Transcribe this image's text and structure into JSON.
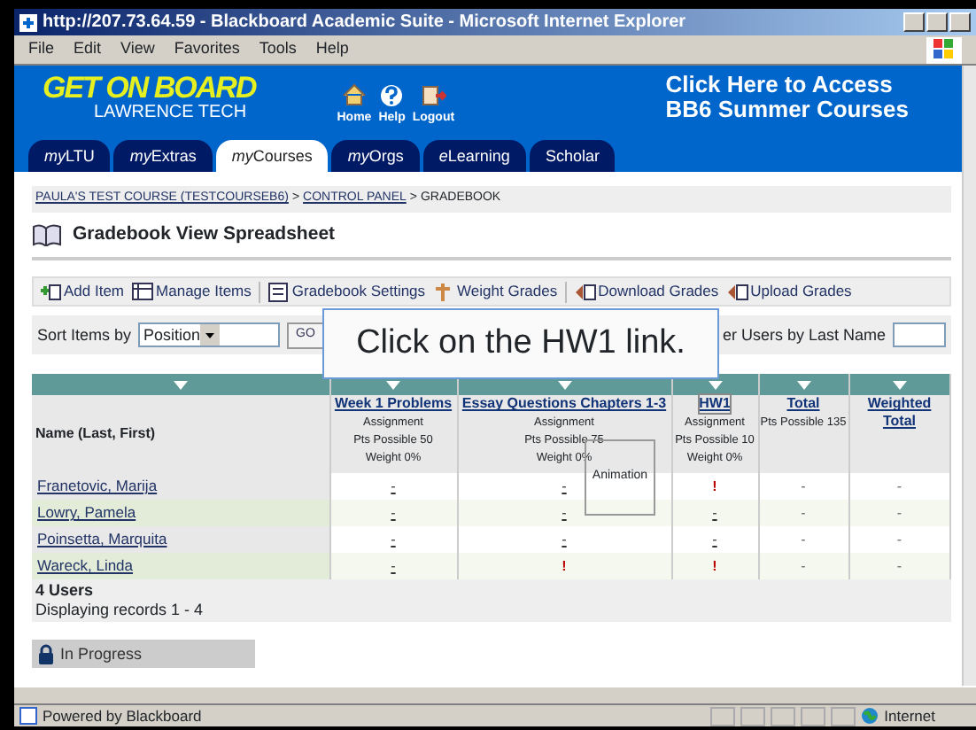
{
  "window": {
    "title": "http://207.73.64.59 - Blackboard Academic Suite - Microsoft Internet Explorer"
  },
  "menu": [
    "File",
    "Edit",
    "View",
    "Favorites",
    "Tools",
    "Help"
  ],
  "header": {
    "logo_top": "GET ON BOARD",
    "logo_bottom": "LAWRENCE TECH",
    "nav_links": [
      "Home",
      "Help",
      "Logout"
    ],
    "promo_lines": [
      "Click Here to Access",
      "BB6 Summer Courses"
    ]
  },
  "tabs": [
    {
      "prefix": "my",
      "label": "LTU",
      "selected": false
    },
    {
      "prefix": "my",
      "label": "Extras",
      "selected": false
    },
    {
      "prefix": "my",
      "label": "Courses",
      "selected": true
    },
    {
      "prefix": "my",
      "label": "Orgs",
      "selected": false
    },
    {
      "prefix": "e",
      "label": "Learning",
      "selected": false
    },
    {
      "label": "Scholar",
      "selected": false
    }
  ],
  "breadcrumb": [
    {
      "text": "PAULA'S TEST COURSE (TESTCOURSEB6)",
      "link": true,
      "separator": ">"
    },
    {
      "text": "CONTROL PANEL",
      "link": true,
      "separator": ">"
    },
    {
      "text": "GRADEBOOK",
      "link": false
    }
  ],
  "page_title": "Gradebook View Spreadsheet",
  "toolbar": [
    "Add Item",
    "Manage Items",
    "Gradebook Settings",
    "Weight Grades",
    "Download Grades",
    "Upload Grades"
  ],
  "sort": {
    "label": "Sort Items by",
    "value": "Position",
    "button": "GO"
  },
  "filter_label": "er Users by Last Name",
  "callout": "Click on the HW1 link.",
  "table": {
    "name_header": "Name (Last, First)",
    "columns": [
      {
        "title": "Week 1 Problems",
        "type": "Assignment",
        "points": "Pts Possible 50",
        "weight": "Weight 0%",
        "focused": false
      },
      {
        "title": "Essay Questions Chapters 1-3",
        "type": "Assignment",
        "points": "Pts Possible 75",
        "weight": "Weight 0%",
        "focused": false
      },
      {
        "title": "HW1",
        "type": "Assignment",
        "points": "Pts Possible 10",
        "weight": "Weight 0%",
        "focused": true
      },
      {
        "title": "Total",
        "points": "Pts Possible 135",
        "focused": false
      },
      {
        "title": "Weighted Total",
        "focused": false
      }
    ],
    "rows": [
      {
        "name": "Franetovic, Marija",
        "cells": [
          {
            "text": "-",
            "kind": "link"
          },
          {
            "text": "-",
            "kind": "link"
          },
          {
            "text": "!",
            "kind": "alert"
          },
          {
            "text": "-",
            "kind": "plain"
          },
          {
            "text": "-",
            "kind": "plain"
          }
        ]
      },
      {
        "name": "Lowry, Pamela",
        "cells": [
          {
            "text": "-",
            "kind": "link"
          },
          {
            "text": "-",
            "kind": "link"
          },
          {
            "text": "-",
            "kind": "link"
          },
          {
            "text": "-",
            "kind": "plain"
          },
          {
            "text": "-",
            "kind": "plain"
          }
        ]
      },
      {
        "name": "Poinsetta, Marquita",
        "cells": [
          {
            "text": "-",
            "kind": "link"
          },
          {
            "text": "-",
            "kind": "link"
          },
          {
            "text": "-",
            "kind": "link"
          },
          {
            "text": "-",
            "kind": "plain"
          },
          {
            "text": "-",
            "kind": "plain"
          }
        ]
      },
      {
        "name": "Wareck, Linda",
        "cells": [
          {
            "text": "-",
            "kind": "link"
          },
          {
            "text": "!",
            "kind": "alert"
          },
          {
            "text": "!",
            "kind": "alert"
          },
          {
            "text": "-",
            "kind": "plain"
          },
          {
            "text": "-",
            "kind": "plain"
          }
        ]
      }
    ],
    "users_count": "4 Users",
    "displaying": "Displaying records 1 - 4"
  },
  "animation_label": "Animation",
  "progress_panel": "In Progress",
  "status_bar": {
    "text": "Powered by Blackboard",
    "zone": "Internet"
  }
}
